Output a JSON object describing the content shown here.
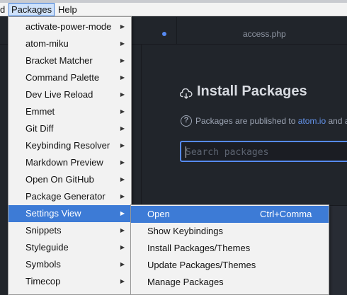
{
  "menubar": {
    "items": [
      {
        "label": "d"
      },
      {
        "label": "Packages"
      },
      {
        "label": "Help"
      }
    ]
  },
  "editor": {
    "tab_title": "access.php"
  },
  "settings": {
    "title": "Install Packages",
    "info_prefix": "Packages are published to ",
    "info_link": "atom.io",
    "info_suffix": " and a",
    "search_placeholder": "Search packages"
  },
  "packages_menu": {
    "items": [
      {
        "label": "activate-power-mode"
      },
      {
        "label": "atom-miku"
      },
      {
        "label": "Bracket Matcher"
      },
      {
        "label": "Command Palette"
      },
      {
        "label": "Dev Live Reload"
      },
      {
        "label": "Emmet"
      },
      {
        "label": "Git Diff"
      },
      {
        "label": "Keybinding Resolver"
      },
      {
        "label": "Markdown Preview"
      },
      {
        "label": "Open On GitHub"
      },
      {
        "label": "Package Generator"
      },
      {
        "label": "Settings View"
      },
      {
        "label": "Snippets"
      },
      {
        "label": "Styleguide"
      },
      {
        "label": "Symbols"
      },
      {
        "label": "Timecop"
      }
    ],
    "highlighted": "Settings View"
  },
  "settings_view_submenu": {
    "items": [
      {
        "label": "Open",
        "shortcut": "Ctrl+Comma"
      },
      {
        "label": "Show Keybindings",
        "shortcut": ""
      },
      {
        "label": "Install Packages/Themes",
        "shortcut": ""
      },
      {
        "label": "Update Packages/Themes",
        "shortcut": ""
      },
      {
        "label": "Manage Packages",
        "shortcut": ""
      }
    ],
    "highlighted": "Open"
  },
  "colors": {
    "menu_highlight": "#3d7bd6",
    "link": "#6494ed",
    "search_border": "#568af2"
  }
}
